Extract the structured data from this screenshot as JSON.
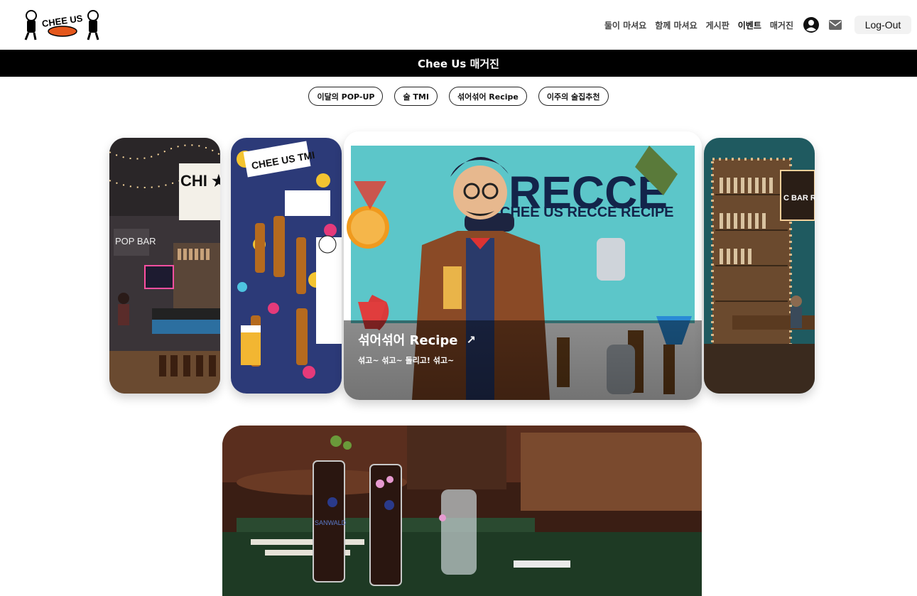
{
  "header": {
    "logo_text": "CHEE US",
    "nav": [
      "둘이 마셔요",
      "함께 마셔요",
      "게시판",
      "이벤트",
      "매거진"
    ],
    "profile_icon": "account-circle-icon",
    "mail_icon": "mail-icon",
    "logout_label": "Log-Out"
  },
  "banner": {
    "title": "Chee Us 매거진"
  },
  "categories": [
    "이달의 POP-UP",
    "술 TMI",
    "섞어섞어 Recipe",
    "이주의 술집추천"
  ],
  "carousel": {
    "cards": [
      {
        "image_text": "CHI ★ PO",
        "sign": "POP BAR"
      },
      {
        "image_text": "CHEE US TMI"
      },
      {
        "image_text": "CHEE US RECCE RECIPE",
        "title": "섞어섞어 Recipe",
        "subtitle": "섞고~ 섞고~ 돌리고! 섞고~",
        "arrow_icon": "arrow-up-right-icon"
      },
      {
        "image_text": "C BAR RE"
      }
    ]
  },
  "featured_photo": {
    "glass_text": "SANWALD"
  },
  "colors": {
    "banner_bg": "#000000",
    "accent_teal": "#5cc6c9",
    "card_dark": "#2c2a2e"
  }
}
